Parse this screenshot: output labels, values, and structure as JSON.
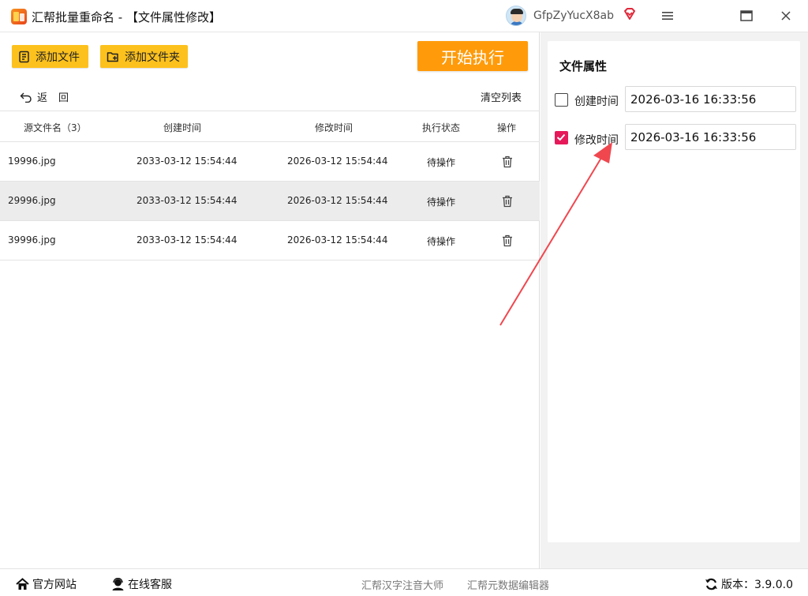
{
  "app": {
    "title": "汇帮批量重命名 - 【文件属性修改】",
    "username": "GfpZyYucX8ab"
  },
  "toolbar": {
    "add_file": "添加文件",
    "add_folder": "添加文件夹",
    "start": "开始执行",
    "back": "返回",
    "clear": "清空列表"
  },
  "table": {
    "headers": [
      "源文件名（3）",
      "创建时间",
      "修改时间",
      "执行状态",
      "操作"
    ],
    "rows": [
      {
        "name": "19996.jpg",
        "created": "2033-03-12 15:54:44",
        "modified": "2026-03-12 15:54:44",
        "status": "待操作"
      },
      {
        "name": "29996.jpg",
        "created": "2033-03-12 15:54:44",
        "modified": "2026-03-12 15:54:44",
        "status": "待操作"
      },
      {
        "name": "39996.jpg",
        "created": "2033-03-12 15:54:44",
        "modified": "2026-03-12 15:54:44",
        "status": "待操作"
      }
    ],
    "selected_row": 1
  },
  "attributes": {
    "title": "文件属性",
    "created_label": "创建时间",
    "created_checked": false,
    "created_value": "2026-03-16 16:33:56",
    "modified_label": "修改时间",
    "modified_checked": true,
    "modified_value": "2026-03-16 16:33:56"
  },
  "footer": {
    "website": "官方网站",
    "support": "在线客服",
    "link1": "汇帮汉字注音大师",
    "link2": "汇帮元数据编辑器",
    "version": "版本：3.9.0.0"
  },
  "colors": {
    "accent_yellow": "#fdc11d",
    "start_orange": "#ff9b0a",
    "check_pink": "#e6195a",
    "annotation_red": "#f0474f"
  },
  "icons": {
    "menu": "hamburger-icon",
    "maximize": "maximize-icon",
    "close": "close-icon",
    "delete": "trash-icon",
    "vip": "vip-diamond-icon"
  }
}
